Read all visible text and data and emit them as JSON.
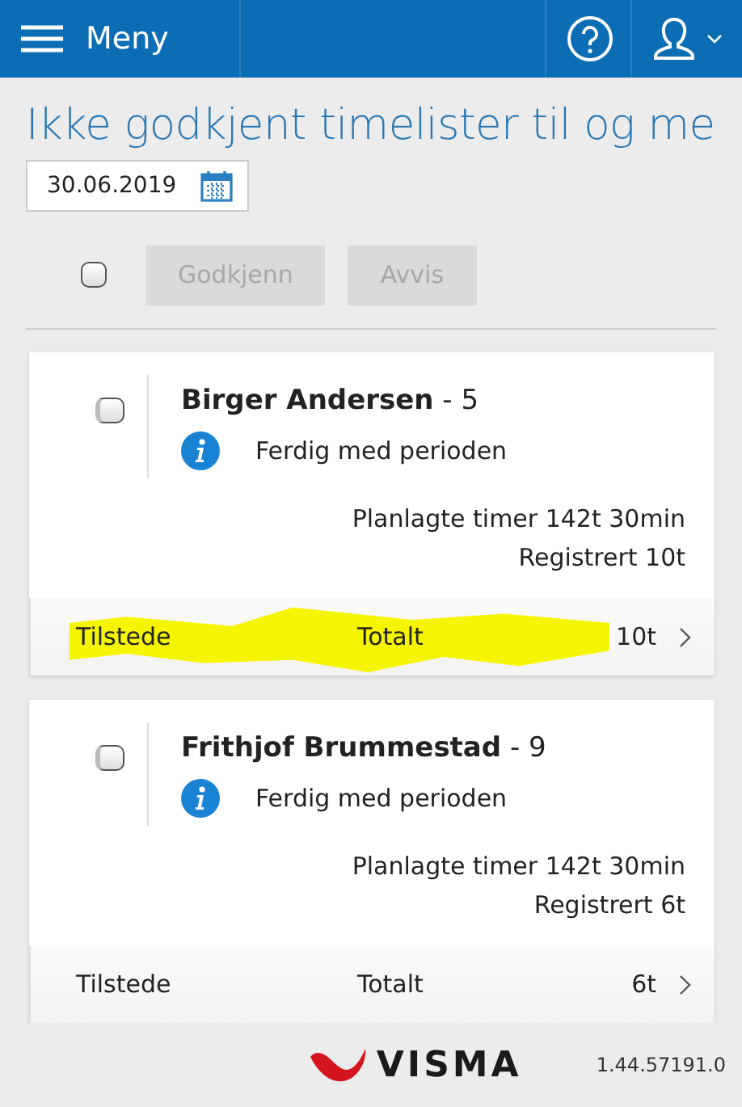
{
  "header": {
    "menu_label": "Meny"
  },
  "title": "Ikke godkjent timelister til og me",
  "date_field": {
    "value": "30.06.2019"
  },
  "toolbar": {
    "select_all": {
      "checked": false
    },
    "buttons": [
      {
        "label": "Godkjenn",
        "disabled": true
      },
      {
        "label": "Avvis",
        "disabled": true
      }
    ]
  },
  "cards": [
    {
      "name": "Birger Andersen",
      "count": "- 5",
      "checked": false,
      "status": "Ferdig med perioden",
      "planned": "Planlagte timer 142t 30min",
      "registered": "Registrert 10t",
      "summary": {
        "present": "Tilstede",
        "total_label": "Totalt",
        "total": "10t",
        "highlighted": true
      }
    },
    {
      "name": "Frithjof Brummestad",
      "count": "- 9",
      "checked": false,
      "status": "Ferdig med perioden",
      "planned": "Planlagte timer 142t 30min",
      "registered": "Registrert 6t",
      "summary": {
        "present": "Tilstede",
        "total_label": "Totalt",
        "total": "6t",
        "highlighted": false
      }
    }
  ],
  "footer": {
    "logo_text": "VISMA",
    "version": "1.44.57191.0"
  }
}
